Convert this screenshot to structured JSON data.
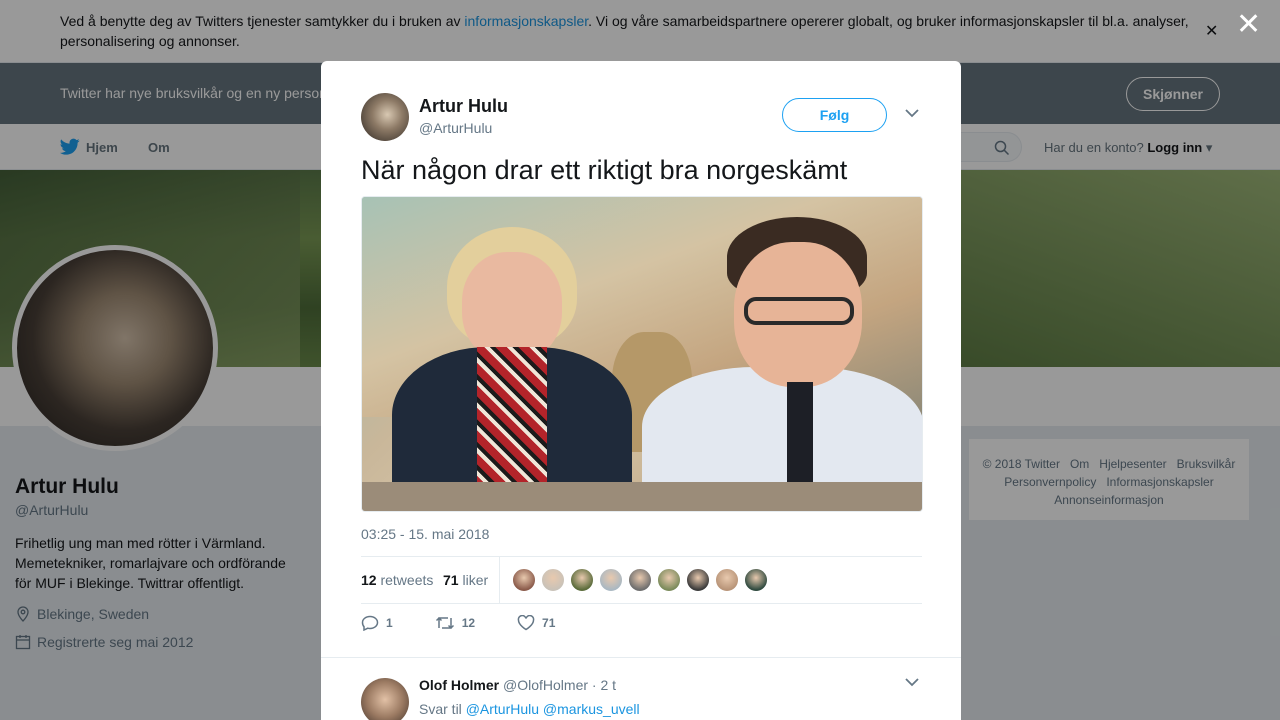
{
  "cookie_banner": {
    "text_before": "Ved å benytte deg av Twitters tjenester samtykker du i bruken av ",
    "link": "informasjonskapsler",
    "text_after": ". Vi og våre samarbeidspartnere opererer globalt, og bruker informasjonskapsler til bl.a. analyser, personalisering og annonser."
  },
  "notice": {
    "text": "Twitter har nye bruksvilkår og en ny personvernpolicy",
    "button": "Skjønner"
  },
  "topnav": {
    "home": "Hjem",
    "about": "Om",
    "login_prefix": "Har du en konto? ",
    "login": "Logg inn"
  },
  "profile": {
    "name": "Artur Hulu",
    "handle": "@ArturHulu",
    "bio": "Frihetlig ung man med rötter i Värmland. Memetekniker, romarlajvare och ordförande för MUF i Blekinge. Twittrar offentligt.",
    "location": "Blekinge, Sweden",
    "joined": "Registrerte seg mai 2012"
  },
  "footer": {
    "links": [
      "© 2018 Twitter",
      "Om",
      "Hjelpesenter",
      "Bruksvilkår",
      "Personvernpolicy",
      "Informasjonskapsler",
      "Annonseinformasjon"
    ]
  },
  "tweet": {
    "name": "Artur Hulu",
    "handle": "@ArturHulu",
    "follow": "Følg",
    "text": "När någon drar ett riktigt bra norgeskämt",
    "timestamp": "03:25 - 15. mai 2018",
    "retweets_count": "12",
    "retweets_label": "retweets",
    "likes_count": "71",
    "likes_label": "liker",
    "liker_colors": [
      "#8a5a4a",
      "#c9c2b8",
      "#5a6b3a",
      "#aab8c2",
      "#6d6d6d",
      "#7a8a5a",
      "#3a3a3a",
      "#b89478",
      "#2f4a3f"
    ],
    "actions": {
      "replies": "1",
      "retweets": "12",
      "likes": "71"
    }
  },
  "reply": {
    "name": "Olof Holmer",
    "handle": "@OlofHolmer",
    "time": "· 2 t",
    "reply_to_label": "Svar til ",
    "reply_to": "@ArturHulu @markus_uvell"
  },
  "colors": {
    "accent": "#1da1f2",
    "link": "#1b95e0",
    "notice_bg": "#66757f"
  }
}
